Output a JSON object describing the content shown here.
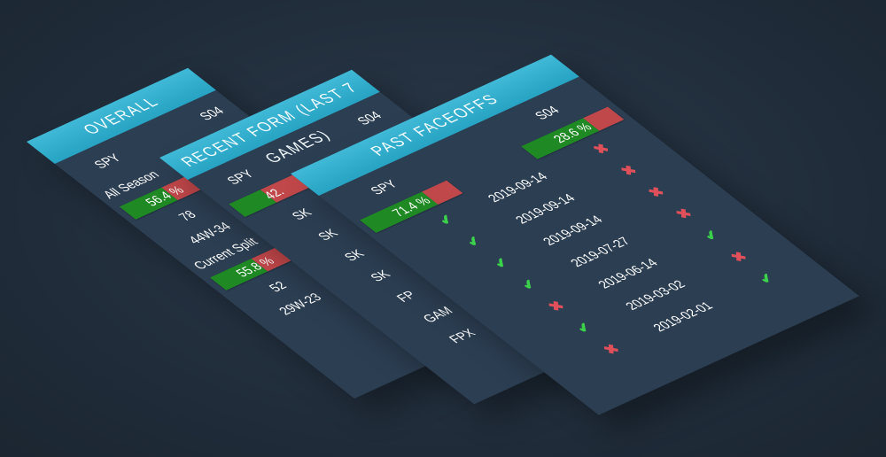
{
  "overall": {
    "title": "OVERALL",
    "team_a": "SPY",
    "team_b": "S04",
    "all_season_label": "All Season",
    "all_season_pct": "56.4 %",
    "all_season_pct_value": 56.4,
    "all_season_games": "78",
    "all_season_record": "44W-34",
    "current_split_label": "Current Split",
    "current_split_pct": "55.8 %",
    "current_split_pct_value": 55.8,
    "current_split_games": "52",
    "current_split_record": "29W-23"
  },
  "recent": {
    "title": "RECENT FORM (LAST 7 GAMES)",
    "team_a": "SPY",
    "team_b": "S04",
    "pct": "42.",
    "pct_value": 42.9,
    "opponents": [
      "SK",
      "SK",
      "SK",
      "SK",
      "FP",
      "GAM",
      "FPX"
    ]
  },
  "faceoffs": {
    "title": "PAST FACEOFFS",
    "team_a": "SPY",
    "team_b": "S04",
    "team_a_pct": "71.4 %",
    "team_a_pct_value": 71.4,
    "team_b_pct": "28.6 %",
    "team_b_pct_value": 28.6,
    "dates": [
      "2019-09-14",
      "2019-09-14",
      "2019-09-14",
      "2019-07-27",
      "2019-06-14",
      "2019-03-02",
      "2019-02-01"
    ],
    "team_a_results": [
      "check",
      "check",
      "check",
      "check",
      "cross",
      "check",
      "cross"
    ],
    "team_b_results": [
      "cross",
      "cross",
      "cross",
      "cross",
      "check",
      "cross",
      "check"
    ]
  },
  "colors": {
    "header": "#2ba8c8",
    "card": "#2c3e52",
    "win": "#1f8a24",
    "loss": "#c0474a",
    "check": "#3bd14a",
    "cross": "#e0505a"
  }
}
